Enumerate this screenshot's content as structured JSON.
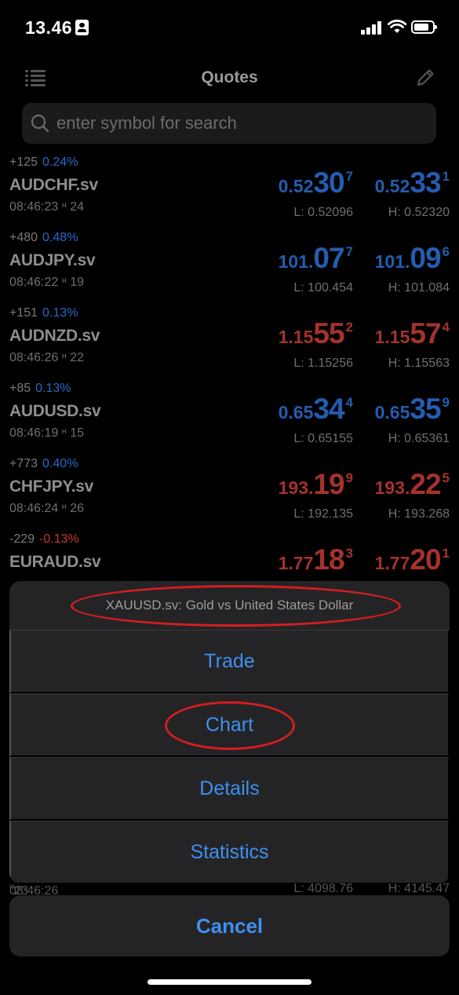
{
  "status_bar": {
    "time": "13.46"
  },
  "nav": {
    "title": "Quotes"
  },
  "search": {
    "placeholder": "enter symbol for search"
  },
  "quotes": [
    {
      "change": "+125",
      "change_pct": "0.24%",
      "symbol": "AUDCHF.sv",
      "time": "08:46:23",
      "ticks": "24",
      "bid": {
        "small": "0.52",
        "big": "30",
        "sup": "7"
      },
      "ask": {
        "small": "0.52",
        "big": "33",
        "sup": "1"
      },
      "low": "L: 0.52096",
      "high": "H: 0.52320"
    },
    {
      "change": "+480",
      "change_pct": "0.48%",
      "symbol": "AUDJPY.sv",
      "time": "08:46:22",
      "ticks": "19",
      "bid": {
        "small": "101.",
        "big": "07",
        "sup": "7"
      },
      "ask": {
        "small": "101.",
        "big": "09",
        "sup": "6"
      },
      "low": "L: 100.454",
      "high": "H: 101.084"
    },
    {
      "change": "+151",
      "change_pct": "0.13%",
      "symbol": "AUDNZD.sv",
      "time": "08:46:26",
      "ticks": "22",
      "bid": {
        "small": "1.15",
        "big": "55",
        "sup": "2"
      },
      "ask": {
        "small": "1.15",
        "big": "57",
        "sup": "4"
      },
      "low": "L: 1.15256",
      "high": "H: 1.15563"
    },
    {
      "change": "+85",
      "change_pct": "0.13%",
      "symbol": "AUDUSD.sv",
      "time": "08:46:19",
      "ticks": "15",
      "bid": {
        "small": "0.65",
        "big": "34",
        "sup": "4"
      },
      "ask": {
        "small": "0.65",
        "big": "35",
        "sup": "9"
      },
      "low": "L: 0.65155",
      "high": "H: 0.65361"
    },
    {
      "change": "+773",
      "change_pct": "0.40%",
      "symbol": "CHFJPY.sv",
      "time": "08:46:24",
      "ticks": "26",
      "bid": {
        "small": "193.",
        "big": "19",
        "sup": "9"
      },
      "ask": {
        "small": "193.",
        "big": "22",
        "sup": "5"
      },
      "low": "L: 192.135",
      "high": "H: 193.268"
    },
    {
      "change": "-229",
      "change_pct": "-0.13%",
      "symbol": "EURAUD.sv",
      "time": "",
      "ticks": "",
      "bid": {
        "small": "1.77",
        "big": "18",
        "sup": "3"
      },
      "ask": {
        "small": "1.77",
        "big": "20",
        "sup": "1"
      },
      "low": "",
      "high": ""
    }
  ],
  "behind_sheet_row": {
    "time": "08:46:26",
    "ticks": "23",
    "low": "L: 4098.76",
    "high": "H: 4145.47"
  },
  "action_sheet": {
    "title": "XAUUSD.sv: Gold vs United States Dollar",
    "options": [
      "Trade",
      "Chart",
      "Details",
      "Statistics"
    ],
    "cancel": "Cancel"
  },
  "colors": {
    "up": "#245db0",
    "down": "#a4322c",
    "action": "#3f8ff0",
    "annotation": "#d41d22"
  },
  "icons": [
    "menu-icon",
    "edit-icon",
    "search-icon",
    "signal-icon",
    "wifi-icon",
    "battery-icon",
    "contact-badge-icon",
    "ticks-icon"
  ]
}
